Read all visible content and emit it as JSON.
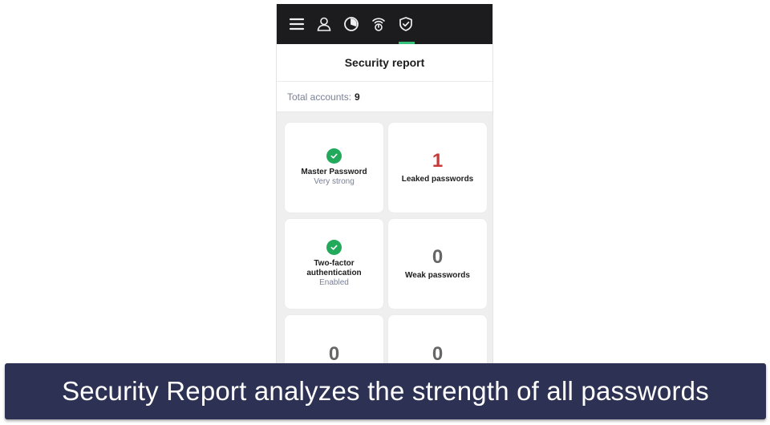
{
  "topbar": {
    "icons": [
      {
        "name": "menu-icon"
      },
      {
        "name": "user-icon"
      },
      {
        "name": "dashboard-icon"
      },
      {
        "name": "wifi-power-icon"
      },
      {
        "name": "shield-check-icon",
        "active": true
      }
    ],
    "active_color": "#35c17a"
  },
  "header": {
    "title": "Security report"
  },
  "summary": {
    "label": "Total accounts:",
    "count": "9"
  },
  "cards": [
    {
      "type": "status",
      "icon": "check-circle-icon",
      "label": "Master Password",
      "sub": "Very strong"
    },
    {
      "type": "count",
      "value": "1",
      "label": "Leaked passwords",
      "color": "#c83a3a"
    },
    {
      "type": "status",
      "icon": "check-circle-icon",
      "label": "Two-factor authentication",
      "label_line1": "Two-factor",
      "label_line2": "authentication",
      "sub": "Enabled"
    },
    {
      "type": "count",
      "value": "0",
      "label": "Weak passwords",
      "color": "#666666"
    },
    {
      "type": "count",
      "value": "0"
    },
    {
      "type": "count",
      "value": "0"
    }
  ],
  "caption": {
    "text": "Security Report analyzes the strength of all passwords",
    "background": "#2d3153"
  }
}
